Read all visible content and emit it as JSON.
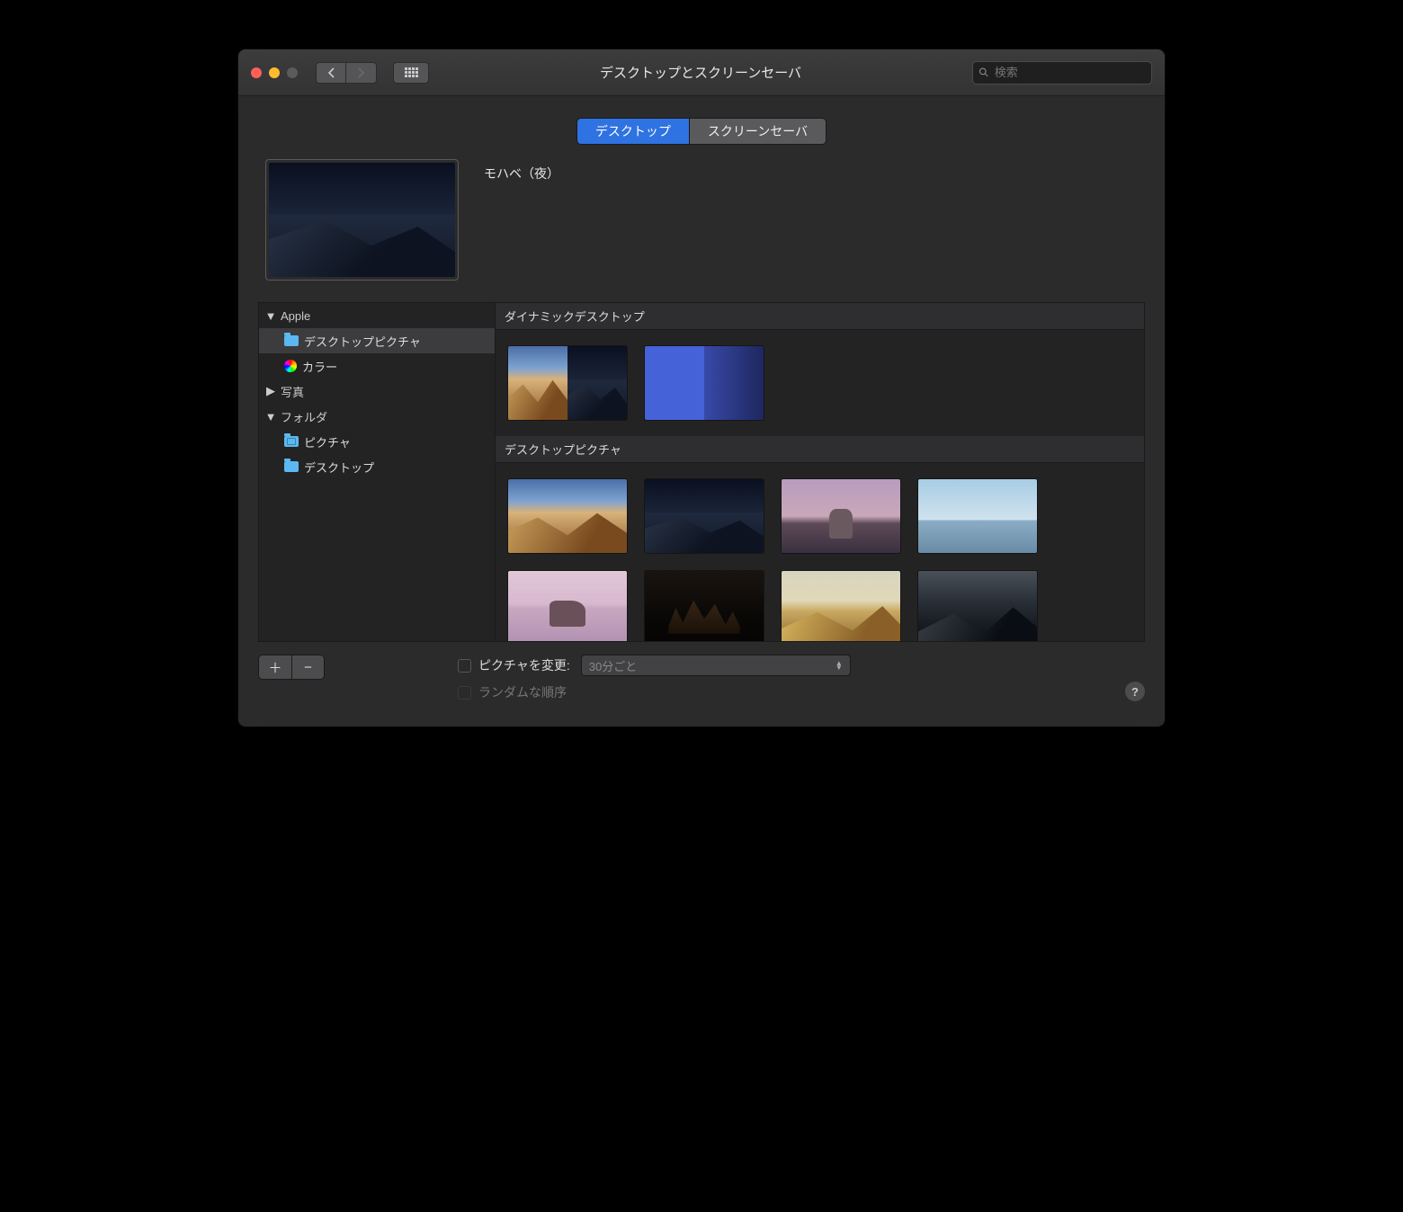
{
  "window_title": "デスクトップとスクリーンセーバ",
  "search": {
    "placeholder": "検索"
  },
  "tabs": {
    "desktop": "デスクトップ",
    "screensaver": "スクリーンセーバ"
  },
  "preview": {
    "name": "モハベ（夜）"
  },
  "sidebar": {
    "apple": "Apple",
    "desktop_pictures": "デスクトップピクチャ",
    "colors": "カラー",
    "photos": "写真",
    "folders": "フォルダ",
    "pictures_folder": "ピクチャ",
    "desktop_folder": "デスクトップ"
  },
  "sections": {
    "dynamic": "ダイナミックデスクトップ",
    "desktop_pictures": "デスクトップピクチャ"
  },
  "footer": {
    "change_picture": "ピクチャを変更:",
    "interval": "30分ごと",
    "random_order": "ランダムな順序"
  }
}
